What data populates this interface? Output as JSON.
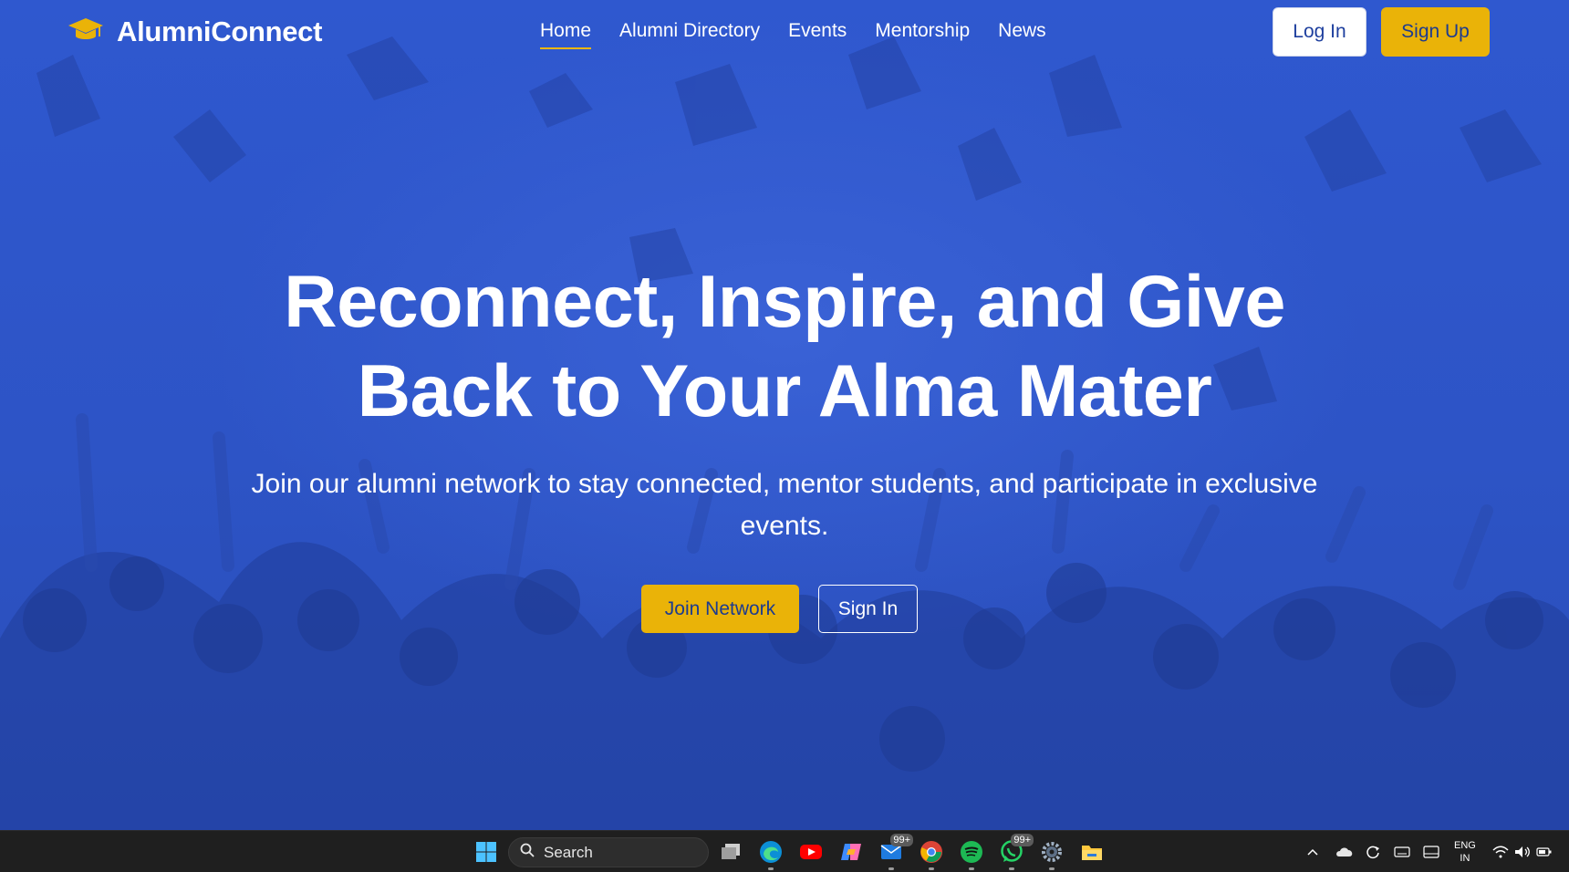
{
  "nav": {
    "brand": "AlumniConnect",
    "links": [
      "Home",
      "Alumni Directory",
      "Events",
      "Mentorship",
      "News"
    ],
    "active": "Home",
    "login_label": "Log In",
    "signup_label": "Sign Up"
  },
  "hero": {
    "headline_line1": "Reconnect, Inspire, and Give",
    "headline_line2": "Back to Your Alma Mater",
    "subtext": "Join our alumni network to stay connected, mentor students, and participate in exclusive events.",
    "primary_cta": "Join Network",
    "secondary_cta": "Sign In"
  },
  "colors": {
    "accent": "#eab308",
    "hero_bg": "#2f56c9",
    "text": "#ffffff"
  },
  "taskbar": {
    "search_placeholder": "Search",
    "icons": [
      "windows-start-icon",
      "task-view-icon",
      "edge-icon",
      "youtube-icon",
      "copilot-icon",
      "mail-icon",
      "chrome-icon",
      "spotify-icon",
      "whatsapp-icon",
      "settings-icon",
      "file-explorer-icon"
    ],
    "mail_badge": "99+",
    "whatsapp_badge": "99+",
    "language_line1": "ENG",
    "language_line2": "IN"
  }
}
